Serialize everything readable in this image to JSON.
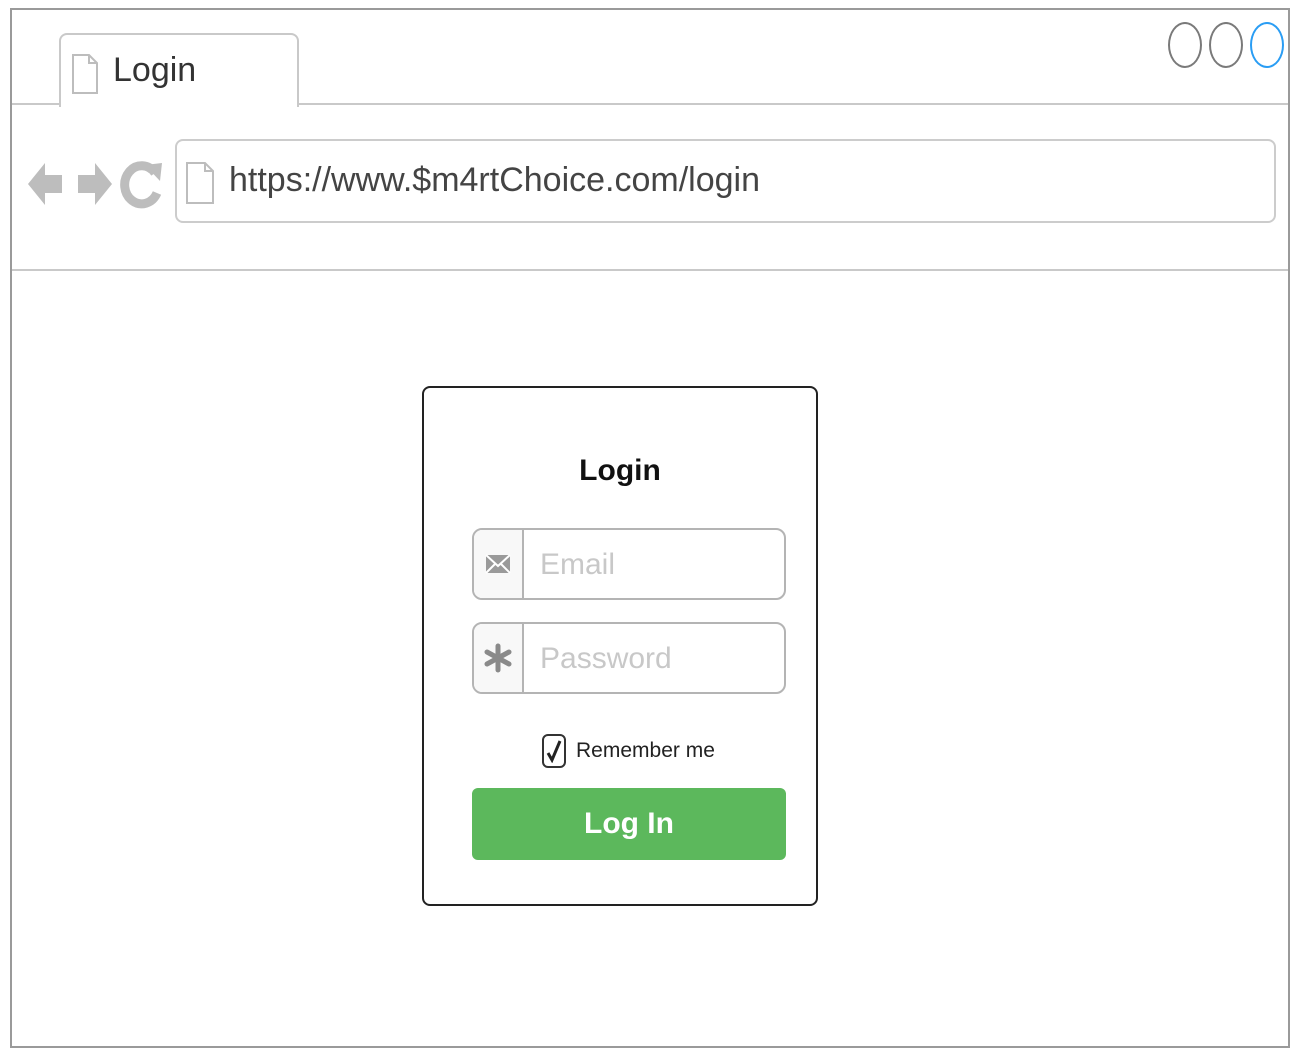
{
  "browser": {
    "tab": {
      "title": "Login",
      "icon": "document-icon"
    },
    "window_controls": [
      {
        "name": "window-control-1",
        "color": "#7a7a7a"
      },
      {
        "name": "window-control-2",
        "color": "#7a7a7a"
      },
      {
        "name": "window-control-3",
        "color": "#2a9df4"
      }
    ],
    "nav": {
      "back_icon": "arrow-left-icon",
      "forward_icon": "arrow-right-icon",
      "reload_icon": "refresh-icon",
      "icon_color": "#bdbdbd"
    },
    "address_bar": {
      "url": "https://www.$m4rtChoice.com/login",
      "icon": "document-icon"
    }
  },
  "login_form": {
    "title": "Login",
    "email": {
      "placeholder": "Email",
      "value": "",
      "icon": "envelope-icon"
    },
    "password": {
      "placeholder": "Password",
      "value": "",
      "icon": "asterisk-icon"
    },
    "remember": {
      "label": "Remember me",
      "checked": true
    },
    "submit": {
      "label": "Log In",
      "color": "#5cb85c"
    }
  }
}
